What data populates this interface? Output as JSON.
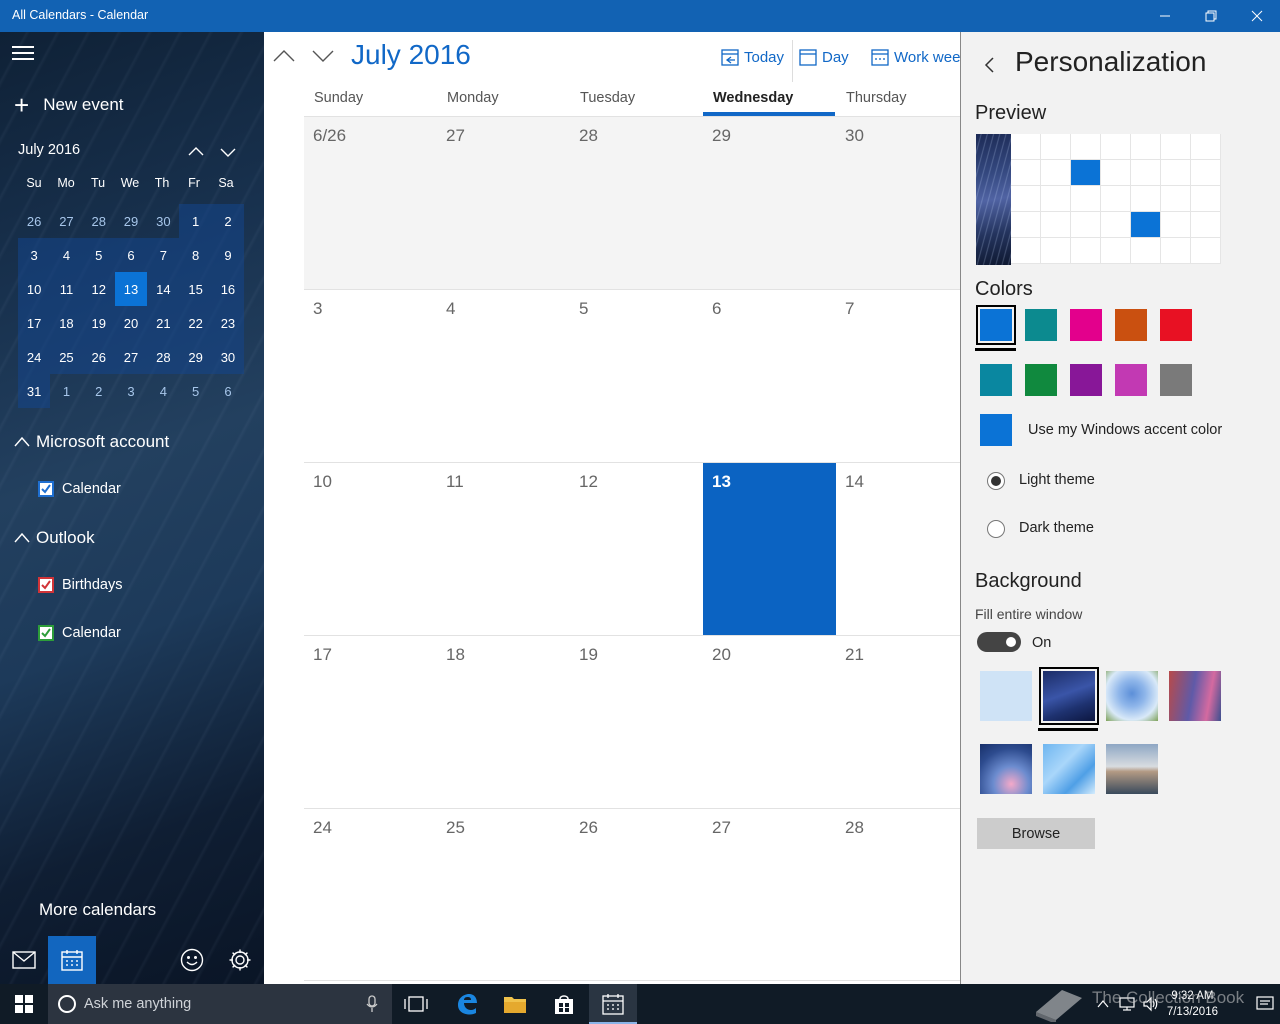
{
  "window": {
    "title": "All Calendars - Calendar"
  },
  "sidebar": {
    "new_event": "New event",
    "mini_calendar": {
      "month_label": "July 2016",
      "weekdays": [
        "Su",
        "Mo",
        "Tu",
        "We",
        "Th",
        "Fr",
        "Sa"
      ],
      "days": [
        "26",
        "27",
        "28",
        "29",
        "30",
        "1",
        "2",
        "3",
        "4",
        "5",
        "6",
        "7",
        "8",
        "9",
        "10",
        "11",
        "12",
        "13",
        "14",
        "15",
        "16",
        "17",
        "18",
        "19",
        "20",
        "21",
        "22",
        "23",
        "24",
        "25",
        "26",
        "27",
        "28",
        "29",
        "30",
        "31",
        "1",
        "2",
        "3",
        "4",
        "5",
        "6"
      ],
      "selected": "13"
    },
    "accounts": [
      {
        "name": "Microsoft account",
        "calendars": [
          {
            "label": "Calendar",
            "color": "#1f6fd1"
          }
        ]
      },
      {
        "name": "Outlook",
        "calendars": [
          {
            "label": "Birthdays",
            "color": "#d13438"
          },
          {
            "label": "Calendar",
            "color": "#2d9d3a"
          }
        ]
      }
    ],
    "more_calendars": "More calendars",
    "bottom_icons": [
      "mail-icon",
      "calendar-icon",
      "smiley-icon",
      "gear-icon"
    ]
  },
  "main": {
    "month_title": "July 2016",
    "toolbar": {
      "today": "Today",
      "day": "Day",
      "work_week": "Work week"
    },
    "days_of_week": [
      "Sunday",
      "Monday",
      "Tuesday",
      "Wednesday",
      "Thursday"
    ],
    "current_day_of_week": "Wednesday",
    "weeks": [
      [
        "6/26",
        "27",
        "28",
        "29",
        "30"
      ],
      [
        "3",
        "4",
        "5",
        "6",
        "7"
      ],
      [
        "10",
        "11",
        "12",
        "13",
        "14"
      ],
      [
        "17",
        "18",
        "19",
        "20",
        "21"
      ],
      [
        "24",
        "25",
        "26",
        "27",
        "28"
      ]
    ],
    "today": "13"
  },
  "personalization": {
    "title": "Personalization",
    "preview_heading": "Preview",
    "colors_heading": "Colors",
    "colors": [
      "#0b73d6",
      "#0c8a8f",
      "#e3008c",
      "#ca5010",
      "#e81123",
      "#0a87a0",
      "#10893e",
      "#881798",
      "#c239b3",
      "#7a7a7a"
    ],
    "selected_color": "#0b73d6",
    "accent_label": "Use my Windows accent color",
    "theme_options": [
      "Light theme",
      "Dark theme"
    ],
    "selected_theme": "Light theme",
    "background_heading": "Background",
    "fill_label": "Fill entire window",
    "fill_state": "On",
    "browse_label": "Browse"
  },
  "taskbar": {
    "search_placeholder": "Ask me anything",
    "time": "9:32 AM",
    "date": "7/13/2016",
    "watermark": "The Collection Book"
  }
}
